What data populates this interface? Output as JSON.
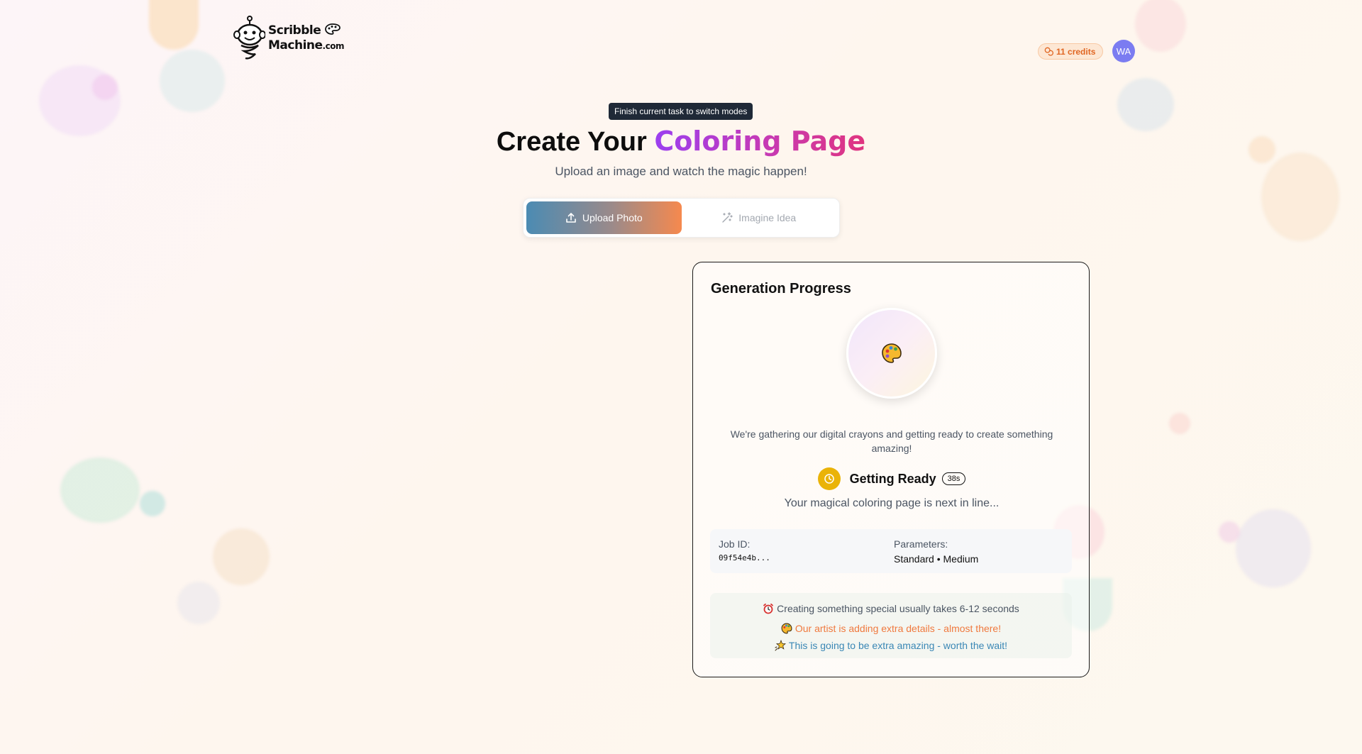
{
  "app": {
    "logo_line1": "Scribble",
    "logo_line2": "Machine",
    "logo_domain": ".com"
  },
  "header": {
    "credits_label": "11 credits",
    "avatar_initials": "WA"
  },
  "hero": {
    "tooltip": "Finish current task to switch modes",
    "title_plain": "Create Your ",
    "title_accent": "Coloring Page",
    "subtitle": "Upload an image and watch the magic happen!"
  },
  "modes": {
    "upload_label": "Upload Photo",
    "imagine_label": "Imagine Idea",
    "active": "upload"
  },
  "progress": {
    "title": "Generation Progress",
    "message": "We're gathering our digital crayons and getting ready to create something amazing!",
    "status_label": "Getting Ready",
    "elapsed": "38s",
    "status_sub": "Your magical coloring page is next in line...",
    "job_id_label": "Job ID:",
    "job_id_value": "09f54e4b...",
    "parameters_label": "Parameters:",
    "parameters_value": "Standard • Medium",
    "tips": [
      "Creating something special usually takes 6-12 seconds",
      "Our artist is adding extra details - almost there!",
      "This is going to be extra amazing - worth the wait!"
    ]
  },
  "colors": {
    "accent_orange": "#f6894e",
    "accent_blue": "#4b8bb3",
    "status_yellow": "#eab308",
    "avatar_purple": "#7b7cf1"
  },
  "icons": [
    "palette-icon",
    "upload-icon",
    "sparkles-icon",
    "clock-icon",
    "alarm-clock-icon",
    "star-icon",
    "coins-icon"
  ]
}
